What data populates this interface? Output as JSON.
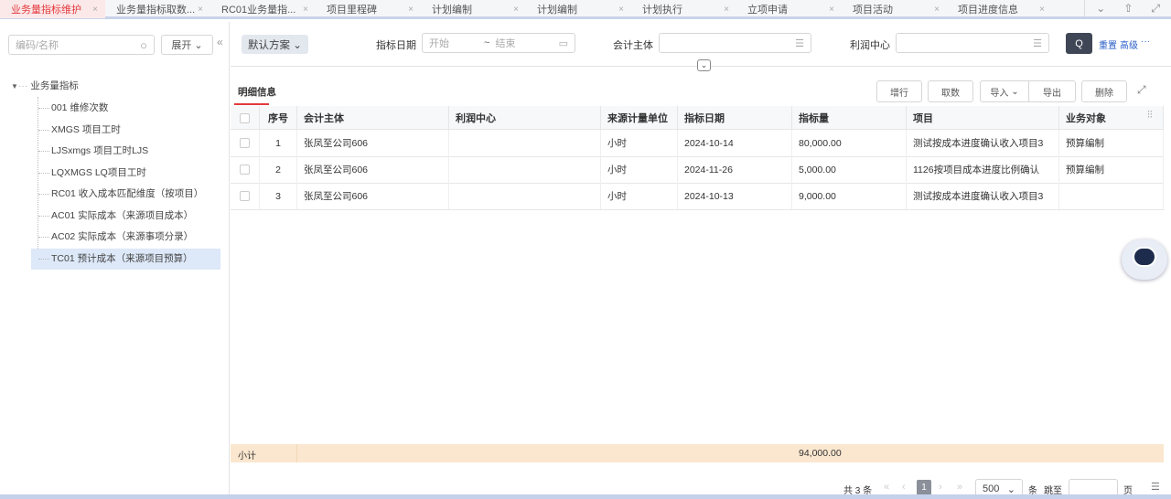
{
  "tabs": [
    {
      "label": "业务量指标维护",
      "active": true
    },
    {
      "label": "业务量指标取数..."
    },
    {
      "label": "RC01业务量指..."
    },
    {
      "label": "项目里程碑"
    },
    {
      "label": "计划编制"
    },
    {
      "label": "计划编制"
    },
    {
      "label": "计划执行"
    },
    {
      "label": "立项申请"
    },
    {
      "label": "项目活动"
    },
    {
      "label": "项目进度信息"
    }
  ],
  "left": {
    "search_placeholder": "编码/名称",
    "expand_label": "展开",
    "root": "业务量指标",
    "items": [
      "001 维修次数",
      "XMGS 项目工时",
      "LJSxmgs 项目工时LJS",
      "LQXMGS LQ项目工时",
      "RC01 收入成本匹配维度（按项目）",
      "AC01 实际成本（来源项目成本）",
      "AC02 实际成本（来源事项分录）",
      "TC01 预计成本（来源项目预算）"
    ],
    "selected_index": 7
  },
  "filter": {
    "scheme": "默认方案",
    "date_label": "指标日期",
    "start_placeholder": "开始",
    "tilde": "~",
    "end_placeholder": "结束",
    "entity_label": "会计主体",
    "profit_label": "利润中心",
    "reset": "重置",
    "advanced": "高级",
    "more": "···"
  },
  "section_title": "明细信息",
  "toolbar": {
    "add_row": "增行",
    "fetch": "取数",
    "import": "导入",
    "export": "导出",
    "delete": "删除"
  },
  "table": {
    "headers": [
      "序号",
      "会计主体",
      "利润中心",
      "来源计量单位",
      "指标日期",
      "指标量",
      "项目",
      "业务对象"
    ],
    "rows": [
      [
        "1",
        "张凤至公司606",
        "",
        "小时",
        "2024-10-14",
        "80,000.00",
        "测试按成本进度确认收入项目3",
        "预算编制"
      ],
      [
        "2",
        "张凤至公司606",
        "",
        "小时",
        "2024-11-26",
        "5,000.00",
        "1126按项目成本进度比例确认",
        "预算编制"
      ],
      [
        "3",
        "张凤至公司606",
        "",
        "小时",
        "2024-10-13",
        "9,000.00",
        "测试按成本进度确认收入项目3",
        ""
      ]
    ],
    "subtotal_label": "小计",
    "subtotal_value": "94,000.00"
  },
  "pagination": {
    "total": "共 3 条",
    "page": "1",
    "page_size": "500",
    "unit": "条",
    "jump": "跳至",
    "page_unit": "页"
  }
}
